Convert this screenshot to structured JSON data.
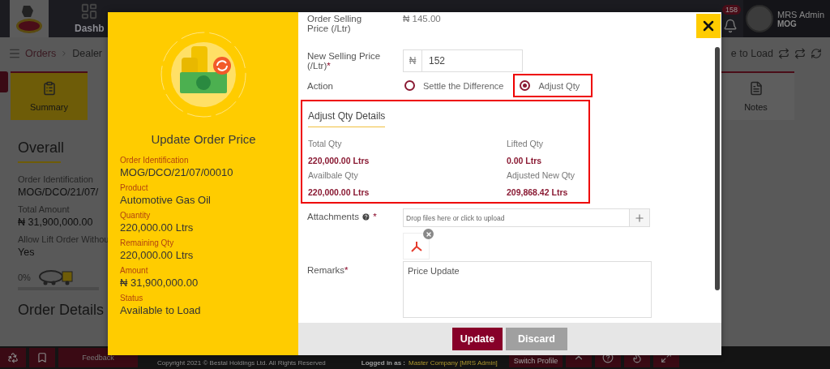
{
  "topbar": {
    "nav": [
      {
        "label": "Dashb"
      }
    ],
    "notification_count": "158",
    "user": {
      "name": "MRS Admin",
      "org": "MOG"
    }
  },
  "breadcrumb": {
    "items": [
      "Orders",
      "Dealer"
    ],
    "status": "e to Load"
  },
  "tabs": [
    {
      "label": "Summary",
      "selected": true
    },
    {
      "label": "Notes",
      "selected": false
    }
  ],
  "overview": {
    "title": "Overall",
    "fields": [
      {
        "label": "Order Identification",
        "value": "MOG/DCO/21/07/"
      },
      {
        "label": "Total Amount",
        "value": "₦ 31,900,000.00"
      },
      {
        "label": "Allow Lift Order Withou",
        "value": "Yes"
      }
    ],
    "progress": {
      "reading": "0%",
      "level": 0
    },
    "section": "Order Details"
  },
  "footer": {
    "feedback": "Feedback",
    "copyright": "Copyright 2021 © Bestal Holdings Ltd. All Rights Reserved",
    "logged_in_label": "Logged in as :",
    "logged_in_value": "Master Company [MRS Admin]",
    "switch": "Switch Profile"
  },
  "modal": {
    "title": "Update Order Price",
    "summary": [
      {
        "label": "Order Identification",
        "value": "MOG/DCO/21/07/00010"
      },
      {
        "label": "Product",
        "value": "Automotive Gas Oil"
      },
      {
        "label": "Quantity",
        "value": "220,000.00 Ltrs"
      },
      {
        "label": "Remaining Qty",
        "value": "220,000.00 Ltrs"
      },
      {
        "label": "Amount",
        "value": "₦ 31,900,000.00"
      },
      {
        "label": "Status",
        "value": "Available to Load"
      }
    ],
    "form": {
      "order_price": {
        "label": "Order Selling Price (/Ltr)",
        "value": "₦ 145.00"
      },
      "new_price": {
        "label": "New Selling Price (/Ltr)",
        "required_mark": "*",
        "prefix": "₦",
        "value": "152"
      },
      "action": {
        "label": "Action",
        "options": [
          {
            "label": "Settle the Difference",
            "selected": false,
            "highlighted": false
          },
          {
            "label": "Adjust Qty",
            "selected": true,
            "highlighted": true
          }
        ]
      },
      "details": {
        "title": "Adjust Qty Details",
        "highlighted": true,
        "items": [
          {
            "label": "Total Qty",
            "value": "220,000.00 Ltrs"
          },
          {
            "label": "Lifted Qty",
            "value": "0.00 Ltrs"
          },
          {
            "label": "Availbale Qty",
            "value": "220,000.00 Ltrs"
          },
          {
            "label": "Adjusted New Qty",
            "value": "209,868.42 Ltrs"
          }
        ]
      },
      "attachments": {
        "label": "Attachments",
        "required_mark": "*",
        "placeholder": "Drop files here or click to upload",
        "files": [
          {
            "kind": "pdf"
          }
        ]
      },
      "remarks": {
        "label": "Remarks",
        "required_mark": "*",
        "value": "Price Update"
      }
    },
    "buttons": [
      {
        "label": "Update",
        "kind": "primary"
      },
      {
        "label": "Discard",
        "kind": "secondary"
      }
    ]
  }
}
